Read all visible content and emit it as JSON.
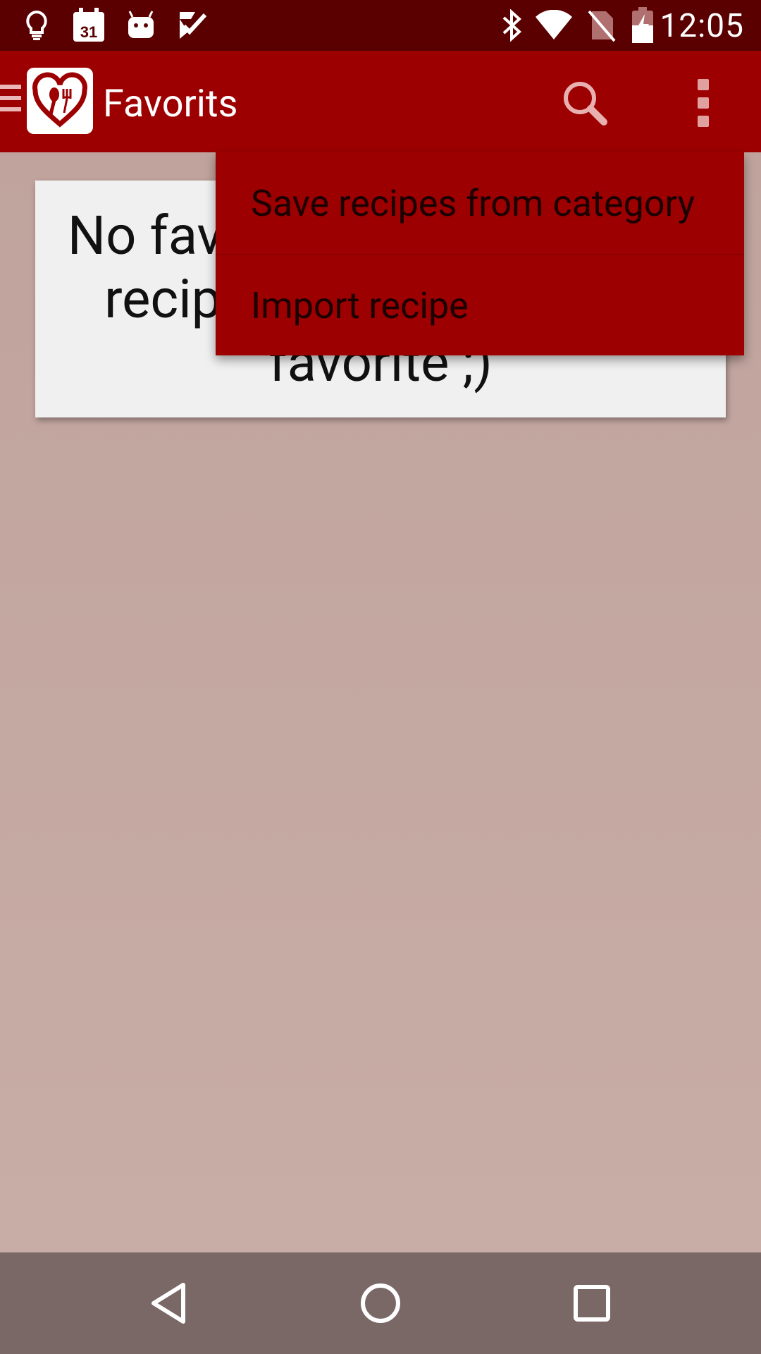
{
  "status_bar": {
    "time": "12:05",
    "calendar_day": "31",
    "icons": [
      "lightbulb-icon",
      "calendar-icon",
      "android-icon",
      "task-check-icon",
      "bluetooth-icon",
      "wifi-icon",
      "no-sim-icon",
      "battery-charging-icon"
    ]
  },
  "app_bar": {
    "title": "Favorits",
    "accent_color": "#9d0000"
  },
  "empty_message": "No favorites yet - mark the recipes you like as your favorite ;)",
  "overflow_menu": {
    "items": [
      {
        "label": "Save recipes from category"
      },
      {
        "label": "Import recipe"
      }
    ]
  },
  "nav_bar": {
    "buttons": [
      "back-icon",
      "home-icon",
      "recents-icon"
    ]
  }
}
